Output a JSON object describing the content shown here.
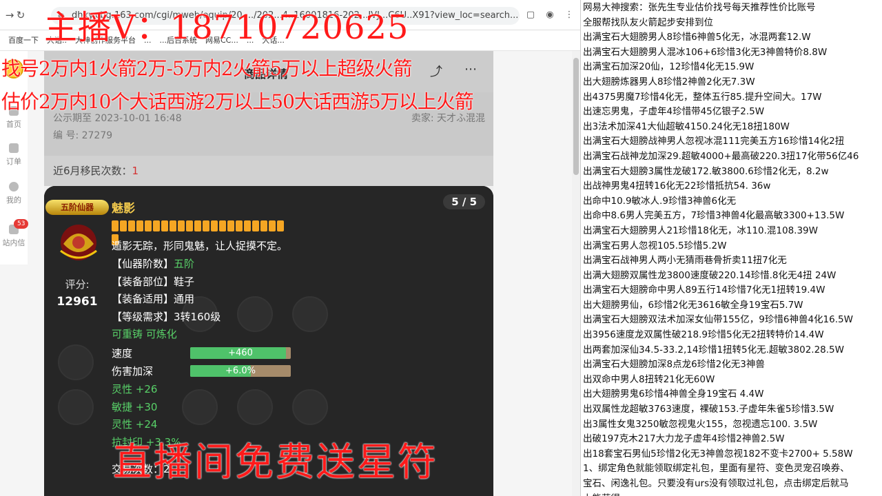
{
  "browser": {
    "url": "dhxy.cbg.163.com/cgi/mweb/equip/20..../202...4..16001816-202...JVJ...C6U..X91?view_loc=search...",
    "bookmarks": [
      "百度一下",
      "大话..",
      "大神创作服务平台",
      "...",
      "...后台系统",
      "网易CC...",
      "...",
      "大话..."
    ]
  },
  "sidenav": {
    "home": "首页",
    "orders": "订单",
    "mine": "我的",
    "messages": "站内信",
    "badge": "53"
  },
  "page": {
    "title": "商品详情",
    "publicity": "公示期至 2023-10-01 16:48",
    "seller": "卖家: 天才ふ混混",
    "serial": "编 号: 27279",
    "migration_label": "近6月移民次数：",
    "migration_count": "1"
  },
  "item": {
    "badge": "五阶仙器",
    "page_count": "5 / 5",
    "name": "魅影",
    "star_count": 22,
    "score_label": "评分:",
    "score": "12961",
    "desc": "遁影无踪，形同鬼魅，让人捉摸不定。",
    "lines": [
      {
        "k": "【仙器阶数】",
        "v": "五阶"
      },
      {
        "k": "【装备部位】",
        "v": "鞋子"
      },
      {
        "k": "【装备适用】",
        "v": "通用"
      },
      {
        "k": "【等级需求】",
        "v": "3转160级"
      }
    ],
    "recast": "可重铸 可炼化",
    "bars": [
      {
        "label": "速度",
        "value": "+460",
        "fill": 0.95
      },
      {
        "label": "伤害加深",
        "value": "+6.0%",
        "fill": 0.6
      }
    ],
    "attrs": [
      "灵性 +26",
      "敏捷 +30",
      "灵性 +24",
      "抗封印 +3.3%"
    ],
    "trade": "交易次数：2"
  },
  "overlay": {
    "line1": "主播V：18710720625",
    "line2": "找号2万内1火箭2万-5万内2火箭5万以上超级火箭",
    "line3": "估价2万内10个大话西游2万以上50大话西游5万以上火箭",
    "line4": "直播间免费送星符"
  },
  "notes": [
    "网易大神搜索：张先生专业估价找号每天推荐性价比账号",
    "全服帮找队友火箭起步安排到位",
    "出满宝石大翅膀男人8珍惜6神兽5化无，冰混两套12.W",
    "出满宝石大翅膀男人混冰106+6珍惜3化无3神兽特价8.8W",
    "出满宝石加深20仙，12珍惜4化无15.9W",
    "出大翅膀炼器男人8珍惜2神兽2化无7.3W",
    "出4375男魔7珍惜4化无，整体五行85.提升空间大。17W",
    "出速忘男鬼，子虚年4珍惜带45亿银子2.5W",
    "出3法术加深41大仙超敏4150.24化无18扭180W",
    "出满宝石大翅膀战神男人忽视冰混111完美五方16珍惜14化2扭",
    "出满宝石战神龙加深29.超敏4000+最高破220.3扭17化带56亿46",
    "出满宝石大翅膀3属性龙破172.敏3800.6珍惜2化无，8.2w",
    "出战神男鬼4扭转16化无22珍惜抵抗54.  36w",
    "出命中10.9敏冰人.9珍惜3神兽6化无",
    "出命中8.6男人完美五方，7珍惜3神兽4化最高敏3300+13.5W",
    "出满宝石大翅膀男人21珍惜18化无，冰110.混108.39W",
    "出满宝石男人忽视105.5珍惜5.2W",
    "出满宝石战神男人两小无猜雨巷骨折卖11扭7化无",
    "出满大翅膀双属性龙3800速度破220.14珍惜.8化无4扭 24W",
    "出满宝石大翅膀命中男人89五行14珍惜7化无1扭转19.4W",
    "出大翅膀男仙，6珍惜2化无3616敏全身19宝石5.7W",
    "出满宝石大翅膀双法术加深女仙带155亿，9珍惜6神兽4化16.5W",
    "出3956速度龙双属性破218.9珍惜5化无2扭转特价14.4W",
    "出两套加深仙34.5-33.2,14珍惜1扭转5化无.超敏3802.28.5W",
    "出满宝石大翅膀加深8点龙6珍惜2化无3神兽",
    "出双命中男人8扭转21化无60W",
    "出大翅膀男鬼6珍惜4神兽全身19宝石 4.4W",
    "出双属性龙超敏3763速度，裸破153.子虚年朱雀5珍惜3.5W",
    "出3属性女鬼3250敏忽视鬼火155，忽视遗忘100.  3.5W",
    "出破197克木217大力龙子虚年4珍惜2神兽2.5W",
    "出18套宝石男仙5珍惜2化无3神兽忽视182不变卡2700+ 5.58W",
    "1、绑定角色就能领取绑定礼包，里面有星符、变色灵宠召唤券、",
    "宝石、闲逸礼包。只要没有urs没有领取过礼包，点击绑定后就马",
    "上能获得"
  ]
}
